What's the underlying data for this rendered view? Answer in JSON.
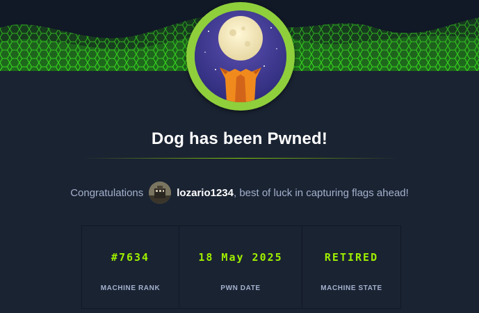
{
  "card": {
    "title": "Dog has been Pwned!",
    "machine_avatar_icon": "dog-moon-machine-icon",
    "banner_icon": "green-hexagon-wave-banner"
  },
  "congrats": {
    "prefix": "Congratulations",
    "username": "lozario1234",
    "suffix": ", best of luck in capturing flags ahead!"
  },
  "stats": [
    {
      "value": "#7634",
      "label": "MACHINE RANK"
    },
    {
      "value": "18 May 2025",
      "label": "PWN DATE"
    },
    {
      "value": "RETIRED",
      "label": "MACHINE STATE"
    }
  ],
  "colors": {
    "background": "#1a2332",
    "accent": "#9fef00",
    "ring": "#8fcf3c",
    "muted_text": "#a4b1cd"
  }
}
